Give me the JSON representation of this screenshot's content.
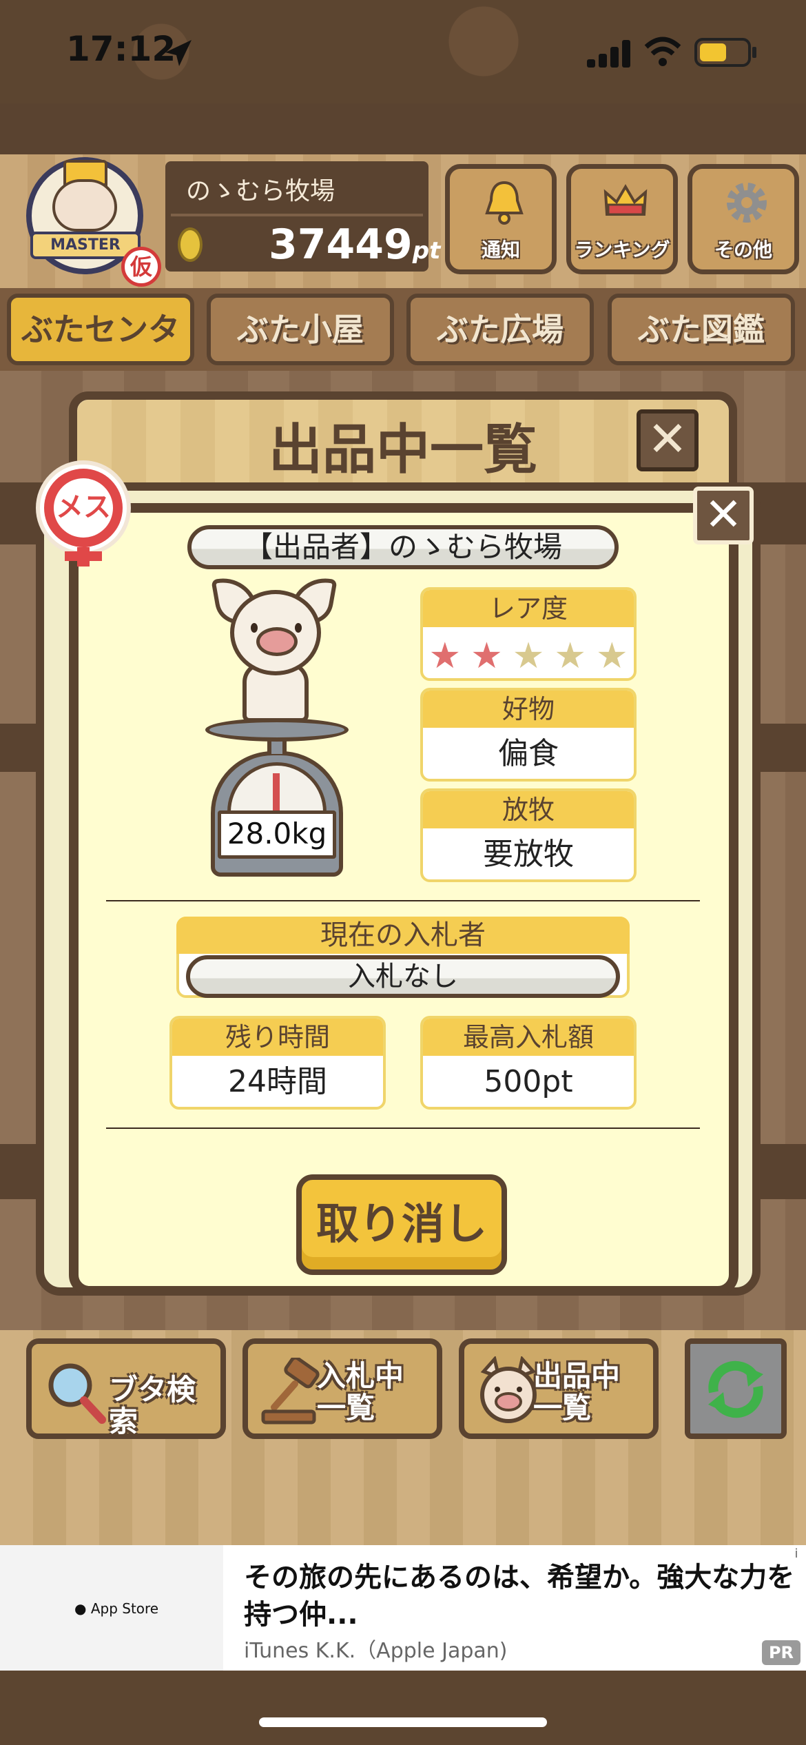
{
  "status_bar": {
    "time": "17:12"
  },
  "header": {
    "badge_text": "MASTER",
    "kari": "仮",
    "farm_name": "のゝむら牧場",
    "points": "37449",
    "points_unit": "pt",
    "buttons": [
      {
        "label": "通知",
        "icon": "bell-icon"
      },
      {
        "label": "ランキング",
        "icon": "crown-icon"
      },
      {
        "label": "その他",
        "icon": "gear-icon"
      }
    ]
  },
  "tabs": [
    {
      "label": "ぶたセンター",
      "active": true
    },
    {
      "label": "ぶた小屋",
      "active": false
    },
    {
      "label": "ぶた広場",
      "active": false
    },
    {
      "label": "ぶた図鑑",
      "active": false
    }
  ],
  "list_panel": {
    "title": "出品中一覧",
    "close": "✕"
  },
  "detail": {
    "close": "✕",
    "sex": "メス",
    "seller": "【出品者】のゝむら牧場",
    "weight": "28.0kg",
    "rarity": {
      "label": "レア度",
      "stars_filled": 2,
      "stars_total": 5
    },
    "favorite": {
      "label": "好物",
      "value": "偏食"
    },
    "grazing": {
      "label": "放牧",
      "value": "要放牧"
    },
    "bidder": {
      "label": "現在の入札者",
      "value": "入札なし"
    },
    "remaining": {
      "label": "残り時間",
      "value": "24時間"
    },
    "max_bid": {
      "label": "最高入札額",
      "value": "500pt"
    },
    "cancel": "取り消し"
  },
  "toolbar": {
    "search": "ブタ検索",
    "bidding_line1": "入札中",
    "bidding_line2": "一覧",
    "listing_line1": "出品中",
    "listing_line2": "一覧"
  },
  "ad": {
    "store": "App Store",
    "title": "その旅の先にあるのは、希望か。強大な力を持つ仲...",
    "advertiser": "iTunes K.K.（Apple Japan)",
    "pr": "PR",
    "info": "i"
  }
}
